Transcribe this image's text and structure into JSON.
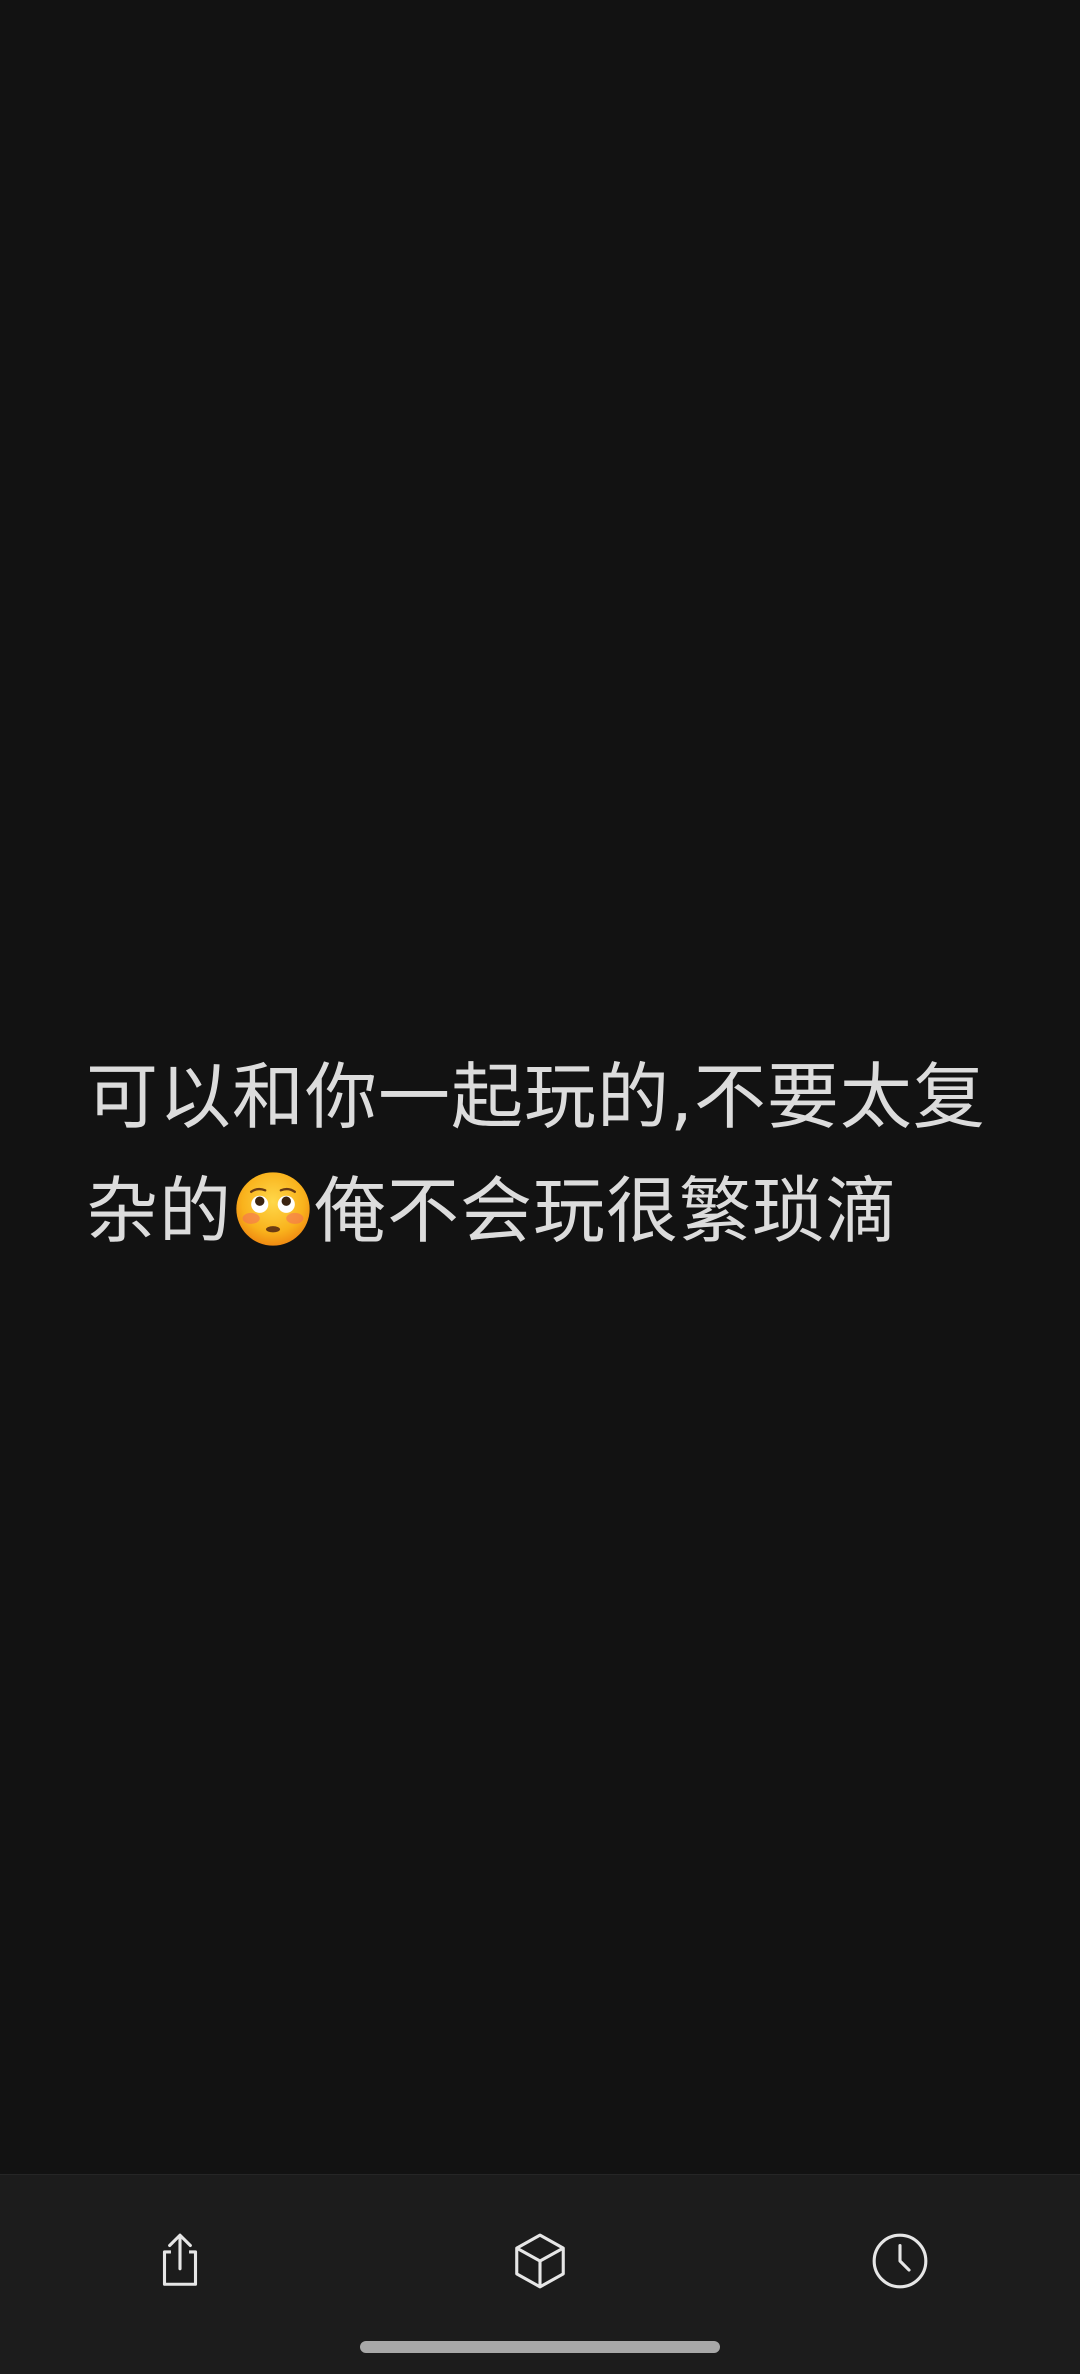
{
  "message": {
    "line1": "可以和你一起玩的,不要太复",
    "line2_before": "杂的",
    "emoji": "flushed-face-icon",
    "line2_after": "俺不会玩很繁琐滴"
  },
  "toolbar": {
    "buttons": [
      {
        "name": "share",
        "icon": "share-icon"
      },
      {
        "name": "cube",
        "icon": "cube-icon"
      },
      {
        "name": "history",
        "icon": "clock-icon"
      }
    ]
  },
  "colors": {
    "background": "#121212",
    "bar": "#1c1c1c",
    "text": "#dcdcdc",
    "icon": "#e6e6e6",
    "indicator": "#a8a8a8"
  }
}
